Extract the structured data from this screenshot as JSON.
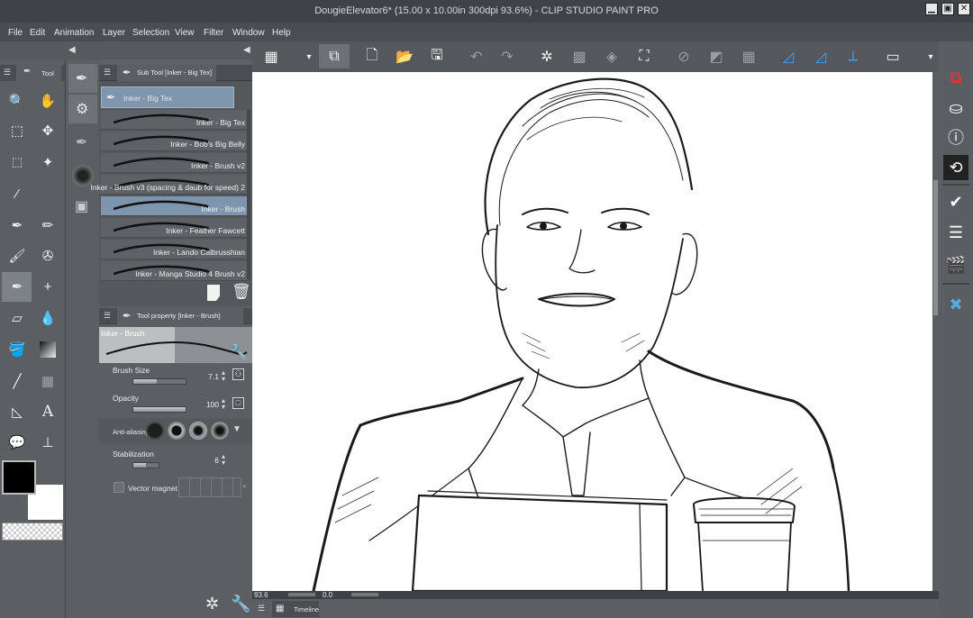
{
  "window": {
    "title": "DougieElevator6* (15.00 x 10.00in 300dpi 93.6%) - CLIP STUDIO PAINT PRO",
    "minimize": "▁",
    "maximize": "▣",
    "close": "✕"
  },
  "menu": [
    "File",
    "Edit",
    "Animation",
    "Layer",
    "Selection",
    "View",
    "Filter",
    "Window",
    "Help"
  ],
  "tool_panel": {
    "tab_label": "Tool",
    "main_color": "#000000",
    "sub_color": "#ffffff"
  },
  "sub_tool_panel": {
    "tab_label": "Sub Tool [Inker - Big Tex]",
    "group_label": "Inker - Big Tex",
    "brushes": [
      "Inker - Big Tex",
      "Inker - Bob's Big Belly",
      "Inker - Brush v2",
      "Inker - Brush v3 (spacing & daub for speed) 2",
      "Inker - Brush",
      "Inker - Feather Fawcett",
      "Inker - Lando Calbrusshian",
      "Inker - Manga Studio 4 Brush v2"
    ],
    "selected_index": 4
  },
  "tool_property": {
    "tab_label": "Tool property [Inker - Brush]",
    "preview_label": "Inker - Brush",
    "brush_size_label": "Brush Size",
    "brush_size_value": "7.1",
    "brush_size_fraction": 0.45,
    "opacity_label": "Opacity",
    "opacity_value": "100",
    "opacity_fraction": 1.0,
    "antialias_label": "Anti-aliasing",
    "stabilization_label": "Stabilization",
    "stabilization_value": "6",
    "stabilization_fraction": 0.5,
    "vector_magnet_label": "Vector magnet"
  },
  "status": {
    "zoom": "93.6",
    "angle": "0.0"
  },
  "timeline": {
    "label": "Timeline"
  },
  "accent": "#7d96ad"
}
